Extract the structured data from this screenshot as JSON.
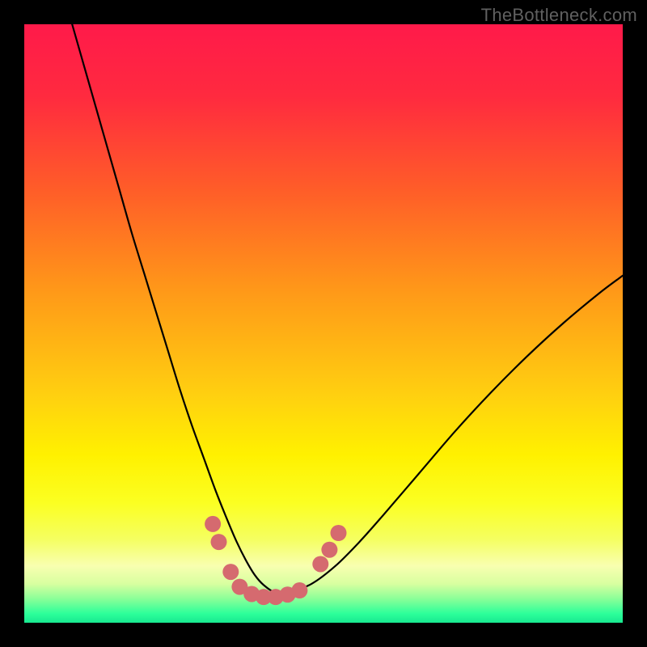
{
  "watermark": {
    "text": "TheBottleneck.com"
  },
  "chart_data": {
    "type": "line",
    "title": "",
    "xlabel": "",
    "ylabel": "",
    "xlim": [
      0,
      100
    ],
    "ylim": [
      0,
      100
    ],
    "background_gradient_stops": [
      {
        "offset": 0.0,
        "color": "#ff1a4a"
      },
      {
        "offset": 0.12,
        "color": "#ff2a3f"
      },
      {
        "offset": 0.28,
        "color": "#ff5e28"
      },
      {
        "offset": 0.45,
        "color": "#ff9a18"
      },
      {
        "offset": 0.62,
        "color": "#ffd010"
      },
      {
        "offset": 0.72,
        "color": "#fff100"
      },
      {
        "offset": 0.8,
        "color": "#fbff22"
      },
      {
        "offset": 0.86,
        "color": "#f5ff60"
      },
      {
        "offset": 0.905,
        "color": "#f8ffb0"
      },
      {
        "offset": 0.935,
        "color": "#d8ffa0"
      },
      {
        "offset": 0.96,
        "color": "#8aff98"
      },
      {
        "offset": 0.985,
        "color": "#2cff9a"
      },
      {
        "offset": 1.0,
        "color": "#18e890"
      }
    ],
    "series": [
      {
        "name": "bottleneck-curve",
        "x": [
          8,
          10,
          12,
          14,
          16,
          18,
          20,
          22,
          24,
          26,
          28,
          30,
          32,
          34,
          35.5,
          37,
          38.5,
          40,
          42,
          44,
          48,
          52,
          56,
          60,
          66,
          72,
          78,
          84,
          90,
          96,
          100
        ],
        "y": [
          100,
          93,
          86,
          79,
          72,
          65,
          58.5,
          52,
          45.5,
          39,
          33,
          27.5,
          22,
          17,
          13.5,
          10.5,
          8,
          6.3,
          5,
          5,
          6.5,
          9.5,
          13.5,
          18,
          25,
          32,
          38.5,
          44.5,
          50,
          55,
          58
        ]
      }
    ],
    "dot_markers": {
      "color": "#d56a6f",
      "radius": 10,
      "points": [
        {
          "x": 31.5,
          "y": 16.5
        },
        {
          "x": 32.5,
          "y": 13.5
        },
        {
          "x": 34.5,
          "y": 8.5
        },
        {
          "x": 36.0,
          "y": 6.0
        },
        {
          "x": 38.0,
          "y": 4.8
        },
        {
          "x": 40.0,
          "y": 4.3
        },
        {
          "x": 42.0,
          "y": 4.3
        },
        {
          "x": 44.0,
          "y": 4.7
        },
        {
          "x": 46.0,
          "y": 5.4
        },
        {
          "x": 49.5,
          "y": 9.8
        },
        {
          "x": 51.0,
          "y": 12.2
        },
        {
          "x": 52.5,
          "y": 15.0
        }
      ]
    }
  }
}
